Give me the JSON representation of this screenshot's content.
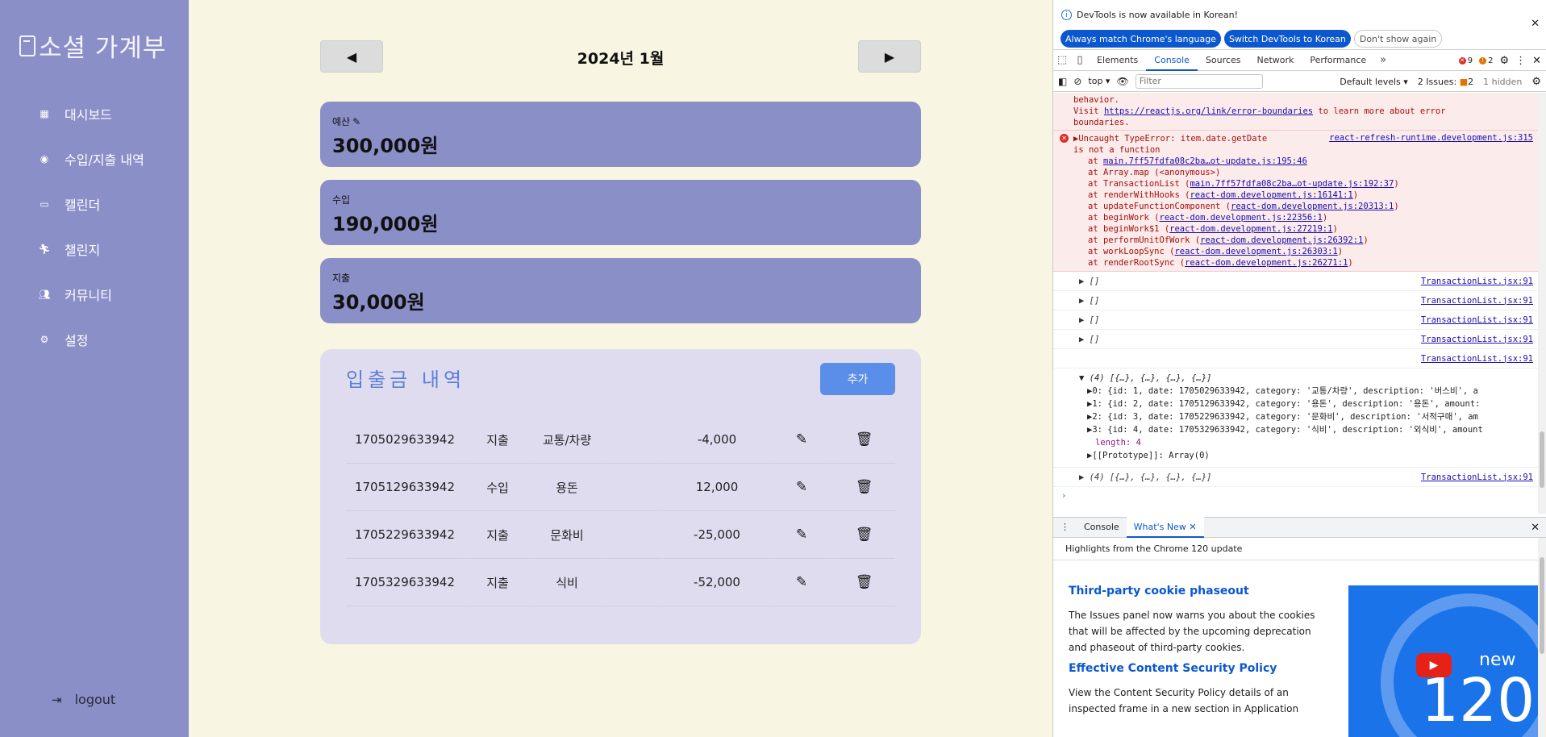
{
  "sidebar": {
    "brand": "소셜 가계부",
    "items": [
      {
        "label": "대시보드",
        "icon": "dashboard-icon"
      },
      {
        "label": "수입/지출 내역",
        "icon": "palette-icon"
      },
      {
        "label": "캘린더",
        "icon": "calendar-icon"
      },
      {
        "label": "챌린지",
        "icon": "running-icon"
      },
      {
        "label": "커뮤니티",
        "icon": "users-icon"
      },
      {
        "label": "설정",
        "icon": "gear-icon"
      }
    ],
    "logout": "logout"
  },
  "month": {
    "title": "2024년 1월",
    "prev": "◀",
    "next": "▶"
  },
  "cards": {
    "budget": {
      "label": "예산",
      "amount": "300,000원"
    },
    "income": {
      "label": "수입",
      "amount": "190,000원"
    },
    "expense": {
      "label": "지출",
      "amount": "30,000원"
    }
  },
  "transactions": {
    "title": "입출금 내역",
    "add_label": "추가",
    "rows": [
      {
        "date": "1705029633942",
        "type": "지출",
        "category": "교통/차량",
        "description": "",
        "amount": "-4,000"
      },
      {
        "date": "1705129633942",
        "type": "수입",
        "category": "용돈",
        "description": "",
        "amount": "12,000"
      },
      {
        "date": "1705229633942",
        "type": "지출",
        "category": "문화비",
        "description": "",
        "amount": "-25,000"
      },
      {
        "date": "1705329633942",
        "type": "지출",
        "category": "식비",
        "description": "",
        "amount": "-52,000"
      }
    ]
  },
  "devtools": {
    "banner": "DevTools is now available in Korean!",
    "btn_match": "Always match Chrome's language",
    "btn_switch": "Switch DevTools to Korean",
    "btn_dismiss": "Don't show again",
    "tabs": [
      "Elements",
      "Console",
      "Sources",
      "Network",
      "Performance"
    ],
    "active_tab": "Console",
    "errors": "9",
    "warnings": "2",
    "context": "top",
    "filter_placeholder": "Filter",
    "levels": "Default levels",
    "issues_label": "2 Issues:",
    "issues_count": "2",
    "hidden": "1 hidden",
    "err_prev_1": "behavior.",
    "err_prev_2a": "Visit ",
    "err_prev_link": "https://reactjs.org/link/error-boundaries",
    "err_prev_2b": " to learn more about error",
    "err_prev_3": "boundaries.",
    "err_msg_1": "▶Uncaught TypeError: item.date.getDate",
    "err_msg_2": "is not a function",
    "err_src": "react-refresh-runtime.development.js:315",
    "stack": [
      {
        "pre": "at ",
        "link": "main.7ff57fdfa08c2ba…ot-update.js:195:46",
        "post": ""
      },
      {
        "pre": "at Array.map (<anonymous>)",
        "link": "",
        "post": ""
      },
      {
        "pre": "at TransactionList (",
        "link": "main.7ff57fdfa08c2ba…ot-update.js:192:37",
        "post": ")"
      },
      {
        "pre": "at renderWithHooks (",
        "link": "react-dom.development.js:16141:1",
        "post": ")"
      },
      {
        "pre": "at updateFunctionComponent (",
        "link": "react-dom.development.js:20313:1",
        "post": ")"
      },
      {
        "pre": "at beginWork (",
        "link": "react-dom.development.js:22356:1",
        "post": ")"
      },
      {
        "pre": "at beginWork$1 (",
        "link": "react-dom.development.js:27219:1",
        "post": ")"
      },
      {
        "pre": "at performUnitOfWork (",
        "link": "react-dom.development.js:26392:1",
        "post": ")"
      },
      {
        "pre": "at workLoopSync (",
        "link": "react-dom.development.js:26303:1",
        "post": ")"
      },
      {
        "pre": "at renderRootSync (",
        "link": "react-dom.development.js:26271:1",
        "post": ")"
      }
    ],
    "log_src": "TransactionList.jsx:91",
    "empty_arr": "▶ []",
    "obj_head": "▼ (4) [{…}, {…}, {…}, {…}]",
    "obj_rows": [
      "▶0: {id: 1, date: 1705029633942, category: '교통/차량', description: '버스비', a",
      "▶1: {id: 2, date: 1705129633942, category: '용돈', description: '용돈', amount:",
      "▶2: {id: 3, date: 1705229633942, category: '문화비', description: '서적구매', am",
      "▶3: {id: 4, date: 1705329633942, category: '식비', description: '외식비', amount"
    ],
    "obj_length": "length: 4",
    "obj_proto": "▶[[Prototype]]: Array(0)",
    "obj_collapsed": "▶ (4) [{…}, {…}, {…}, {…}]",
    "drawer_console": "Console",
    "drawer_whatsnew": "What's New",
    "wn_subtitle": "Highlights from the Chrome 120 update",
    "wn_h1": "Third-party cookie phaseout",
    "wn_p1": "The Issues panel now warns you about the cookies that will be affected by the upcoming deprecation and phaseout of third-party cookies.",
    "wn_h2": "Effective Content Security Policy",
    "wn_p2": "View the Content Security Policy details of an inspected frame in a new section in Application",
    "wn_thumb_new": "new",
    "wn_thumb_num": "120"
  }
}
